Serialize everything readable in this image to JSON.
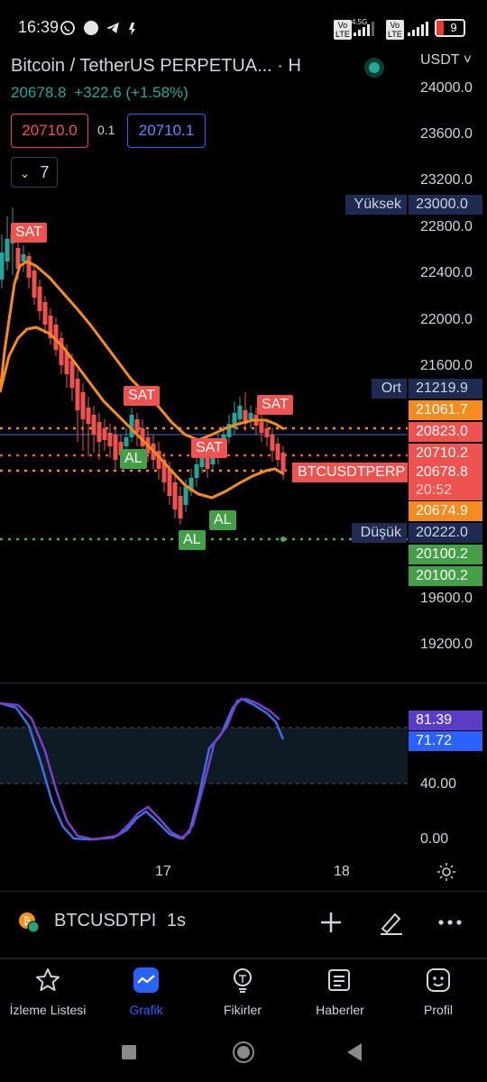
{
  "status_bar": {
    "time": "16:39",
    "network": "4.5G",
    "battery": "9"
  },
  "header": {
    "title": "Bitcoin / TetherUS PERPETUA... · H",
    "price": "20678.8",
    "change": "+322.6 (+1.58%)",
    "currency": "USDT ˅"
  },
  "orders": {
    "sell_price": "20710.0",
    "spread": "0.1",
    "buy_price": "20710.1",
    "indicator_count": "7"
  },
  "price_axis": [
    "24000.0",
    "23600.0",
    "23200.0",
    "22800.0",
    "22400.0",
    "22000.0",
    "21600.0",
    "19600.0",
    "19200.0"
  ],
  "tags": {
    "high_label": "Yüksek",
    "high_value": "23000.0",
    "mid_label": "Ort",
    "mid_value": "21219.9",
    "val_1": "21061.7",
    "val_2": "20823.0",
    "val_3": "20710.2",
    "symbol_label": "BTCUSDTPERP",
    "last_price": "20678.8",
    "countdown": "20:52",
    "val_4": "20674.9",
    "low_label": "Düşük",
    "low_value": "20222.0",
    "val_5": "20100.2",
    "val_6": "20100.2"
  },
  "signals": {
    "sell": "SAT",
    "buy": "AL"
  },
  "oscillator": {
    "value_1": "81.39",
    "value_2": "71.72",
    "level_40": "40.00",
    "level_0": "0.00"
  },
  "time_axis": [
    "17",
    "18"
  ],
  "symbol_bar": {
    "symbol": "BTCUSDTPI",
    "interval": "1s"
  },
  "nav": [
    {
      "label": "İzleme Listesi",
      "icon": "star-icon"
    },
    {
      "label": "Grafik",
      "icon": "chart-icon"
    },
    {
      "label": "Fikirler",
      "icon": "lightbulb-icon"
    },
    {
      "label": "Haberler",
      "icon": "news-icon"
    },
    {
      "label": "Profil",
      "icon": "smiley-icon"
    }
  ],
  "colors": {
    "up": "#26a69a",
    "down": "#ef5350",
    "ma": "#f68c1f",
    "accent": "#2962ff"
  }
}
